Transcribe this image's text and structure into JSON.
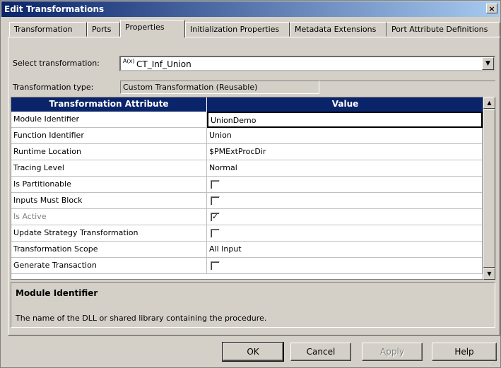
{
  "window": {
    "title": "Edit Transformations",
    "close": "×"
  },
  "tabs": [
    {
      "label": "Transformation"
    },
    {
      "label": "Ports"
    },
    {
      "label": "Properties"
    },
    {
      "label": "Initialization Properties"
    },
    {
      "label": "Metadata Extensions"
    },
    {
      "label": "Port Attribute Definitions"
    }
  ],
  "select_transformation": {
    "label": "Select transformation:",
    "icon_text": "A(x)",
    "value": "CT_Inf_Union"
  },
  "transformation_type": {
    "label": "Transformation type:",
    "value": "Custom Transformation (Reusable)"
  },
  "grid": {
    "headers": [
      "Transformation Attribute",
      "Value"
    ],
    "rows": [
      {
        "attribute": "Module Identifier",
        "value": "UnionDemo"
      },
      {
        "attribute": "Function Identifier",
        "value": "Union"
      },
      {
        "attribute": "Runtime Location",
        "value": "$PMExtProcDir"
      },
      {
        "attribute": "Tracing Level",
        "value": "Normal"
      },
      {
        "attribute": "Is Partitionable",
        "value": ""
      },
      {
        "attribute": "Inputs Must Block",
        "value": ""
      },
      {
        "attribute": "Is Active",
        "value": "✓"
      },
      {
        "attribute": "Update Strategy Transformation",
        "value": ""
      },
      {
        "attribute": "Transformation Scope",
        "value": "All Input"
      },
      {
        "attribute": "Generate Transaction",
        "value": ""
      }
    ]
  },
  "description": {
    "title": "Module Identifier",
    "text": "The name of the DLL or shared library containing the procedure."
  },
  "buttons": {
    "ok": "OK",
    "cancel": "Cancel",
    "apply": "Apply",
    "help": "Help"
  }
}
